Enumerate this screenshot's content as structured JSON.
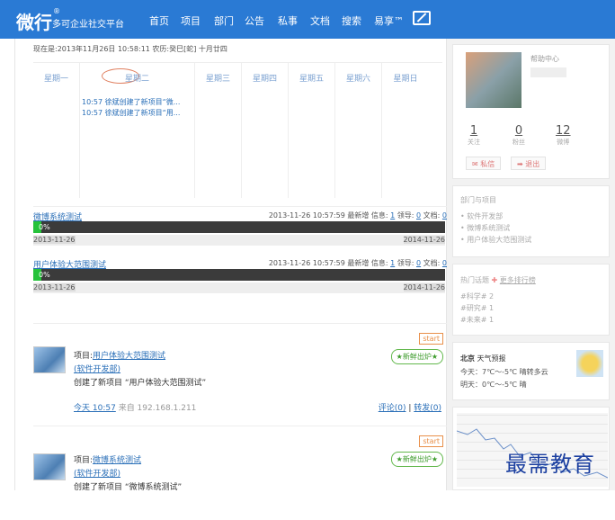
{
  "nav": {
    "brand": "微行",
    "brand_mark": "®",
    "brand_sub": "多可企业社交平台",
    "menu": [
      "首页",
      "项目",
      "部门",
      "公告",
      "私事",
      "文档",
      "搜索",
      "易享™"
    ]
  },
  "calendar": {
    "today": "现在是:2013年11月26日 10:58:11 农历:癸巳[蛇] 十月廿四",
    "days": [
      "星期一",
      "星期二",
      "星期三",
      "星期四",
      "星期五",
      "星期六",
      "星期日"
    ],
    "events": [
      "10:57 徐斌创建了新项目“微...",
      "10:57 徐斌创建了新项目“用..."
    ]
  },
  "projects": [
    {
      "title": "微博系统测试",
      "info_prefix": "2013-11-26 10:57:59 最新增 信息:",
      "info_num": "1",
      "info_lead": "领导:",
      "lead_num": "0",
      "info_doc": "文档:",
      "doc_num": "0",
      "progress_label": "0%",
      "progress": 0.02,
      "start": "2013-11-26",
      "end": "2014-11-26"
    },
    {
      "title": "用户体验大范围测试",
      "info_prefix": "2013-11-26 10:57:59 最新增 信息:",
      "info_num": "1",
      "info_lead": "领导:",
      "lead_num": "0",
      "info_doc": "文档:",
      "doc_num": "0",
      "progress_label": "0%",
      "progress": 0.02,
      "start": "2013-11-26",
      "end": "2014-11-26"
    }
  ],
  "feed": [
    {
      "label": "项目:",
      "project": "用户体验大范围测试",
      "dept": "(软件开发部)",
      "action": "创建了新项目 “用户体验大范围测试”",
      "time": "今天 10:57",
      "from": "来自 192.168.1.211",
      "comment": "评论(0)",
      "repost": "转发(0)",
      "tag_start": "start",
      "tag_new": "★新鲜出炉★"
    },
    {
      "label": "项目:",
      "project": "微博系统测试",
      "dept": "(软件开发部)",
      "action": "创建了新项目 “微博系统测试”",
      "tag_start": "start",
      "tag_new": "★新鲜出炉★"
    }
  ],
  "profile": {
    "help": "帮助中心",
    "stats": [
      {
        "n": "1",
        "l": "关注"
      },
      {
        "n": "0",
        "l": "粉丝"
      },
      {
        "n": "12",
        "l": "微博"
      }
    ],
    "btn_msg": "私信",
    "btn_exit": "退出"
  },
  "dept_box": {
    "title": "部门与项目",
    "items": [
      "软件开发部",
      "微博系统测试",
      "用户体验大范围测试"
    ]
  },
  "topics": {
    "title": "热门话题",
    "more": "更多排行榜",
    "items": [
      "#科学# 2",
      "#研究# 1",
      "#未来# 1"
    ]
  },
  "weather": {
    "city": "北京",
    "title": "天气预报",
    "today": "今天：7℃～-5℃ 晴转多云",
    "tomorrow": "明天：0℃～-5℃ 晴"
  },
  "watermark": "最需教育"
}
